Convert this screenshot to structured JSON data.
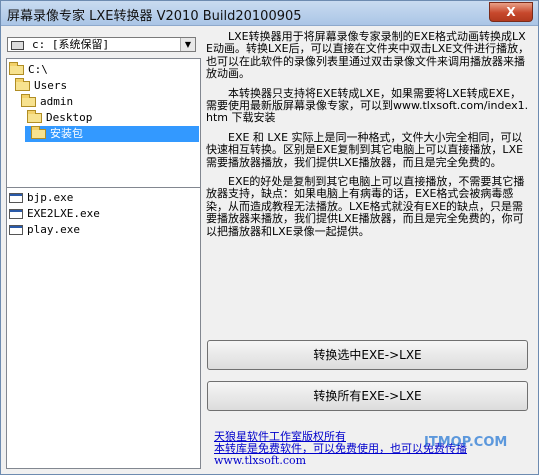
{
  "window": {
    "title": "屏幕录像专家 LXE转换器 V2010 Build20100905",
    "close_label": "X"
  },
  "drive": {
    "selected": "c: [系统保留]"
  },
  "tree": [
    {
      "label": "C:\\"
    },
    {
      "label": "Users"
    },
    {
      "label": "admin"
    },
    {
      "label": "Desktop"
    },
    {
      "label": "安装包"
    }
  ],
  "files": [
    {
      "label": "bjp.exe"
    },
    {
      "label": "EXE2LXE.exe"
    },
    {
      "label": "play.exe"
    }
  ],
  "info": {
    "p1": "LXE转换器用于将屏幕录像专家录制的EXE格式动画转换成LXE动画。转换LXE后，可以直接在文件夹中双击LXE文件进行播放，也可以在此软件的录像列表里通过双击录像文件来调用播放器来播放动画。",
    "p2": "本转换器只支持将EXE转成LXE，如果需要将LXE转成EXE，需要使用最新版屏幕录像专家，可以到www.tlxsoft.com/index1.htm 下载安装",
    "p3": "EXE 和 LXE 实际上是同一种格式，文件大小完全相同，可以快速相互转换。区别是EXE复制到其它电脑上可以直接播放，LXE需要播放器播放，我们提供LXE播放器，而且是完全免费的。",
    "p4": "EXE的好处是复制到其它电脑上可以直接播放，不需要其它播放器支持，缺点：如果电脑上有病毒的话，EXE格式会被病毒感染，从而造成教程无法播放。LXE格式就没有EXE的缺点，只是需要播放器来播放，我们提供LXE播放器，而且是完全免费的，你可以把播放器和LXE录像一起提供。"
  },
  "buttons": {
    "convert_selected": "转换选中EXE->LXE",
    "convert_all": "转换所有EXE->LXE"
  },
  "footer": {
    "copyright": "天狼星软件工作室版权所有",
    "note": "本转库是免费软件，可以免费使用，也可以免费传播",
    "url": "www.tlxsoft.com",
    "watermark": "ITMOP.COM"
  },
  "colors": {
    "selection": "#3399ff",
    "link": "#0000cc",
    "close_button": "#c7482c"
  },
  "icons": {
    "drive": "drive-icon",
    "folder": "folder-icon",
    "exe": "exe-file-icon"
  }
}
